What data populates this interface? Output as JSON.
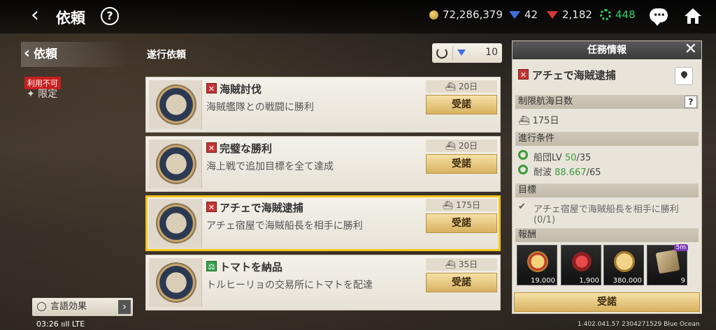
{
  "header": {
    "back_icon": "‹",
    "title": "依頼",
    "help": "?",
    "gold": "72,286,379",
    "sapphire": "42",
    "ruby": "2,182",
    "green_points": "448",
    "green_color": "#2fd06a"
  },
  "sidebar": {
    "active_item": "依頼",
    "unavailable_badge": "利用不可",
    "limited_item": "✦ 限定",
    "lang_button": "言語効果",
    "lang_arrow": "›"
  },
  "status": {
    "time": "03:26",
    "signal": "ııll LTE",
    "version": "1.402.041.57 2304271529 Blue Ocean"
  },
  "list": {
    "section_title": "遂行依頼",
    "refresh_count": "10",
    "quests": [
      {
        "tag": "✕",
        "name": "海賊討伐",
        "desc": "海賊艦隊との戦闘に勝利",
        "days": "⛴ 20日",
        "button": "受諾"
      },
      {
        "tag": "✕",
        "name": "完璧な勝利",
        "desc": "海上戦で追加目標を全て達成",
        "days": "⛴ 20日",
        "button": "受諾"
      },
      {
        "tag": "✕",
        "name": "アチェで海賊逮捕",
        "desc": "アチェ宿屋で海賊船長を相手に勝利",
        "days": "⛴ 175日",
        "button": "受諾"
      },
      {
        "tag": "⚖",
        "name": "トマトを納品",
        "desc": "トルヒーリョの交易所にトマトを配達",
        "days": "⛴ 35日",
        "button": "受諾"
      }
    ]
  },
  "panel": {
    "header": "任務情報",
    "close": "✕",
    "quest_tag": "✕",
    "quest_title": "アチェで海賊逮捕",
    "limit_label": "制限航海日数",
    "limit_help": "?",
    "limit_value": "⛴ 175日",
    "cond_label": "進行条件",
    "cond1_name": "船団LV ",
    "cond1_value": "50",
    "cond1_req": "/35",
    "cond2_name": "耐波 ",
    "cond2_value": "88.667",
    "cond2_req": "/65",
    "goal_label": "目標",
    "goal_check": "✔",
    "goal_text": "アチェ宿屋で海賊船長を相手に勝利",
    "goal_progress": "(0/1)",
    "reward_label": "報酬",
    "rewards": [
      {
        "icon": "medal-icon",
        "count": "19,000"
      },
      {
        "icon": "laurel-star-icon",
        "count": "1,900"
      },
      {
        "icon": "scale-coin-icon",
        "count": "380,000"
      },
      {
        "icon": "map-scroll-icon",
        "count": "9",
        "badge": "5m"
      }
    ],
    "accept": "受諾"
  }
}
